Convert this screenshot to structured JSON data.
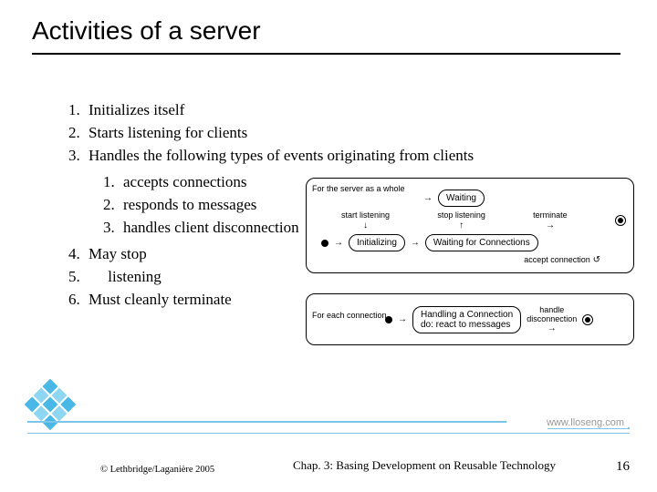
{
  "title": "Activities of a server",
  "list": {
    "items": [
      "Initializes itself",
      "Starts listening for clients",
      "Handles the following types of events originating from clients"
    ],
    "sub_items": [
      "accepts connections",
      "responds to messages",
      "handles client disconnection"
    ],
    "items_after": [
      "May stop",
      "     listening",
      "Must cleanly terminate"
    ]
  },
  "diagram": {
    "group1_label": "For the server as a whole",
    "state_waiting": "Waiting",
    "state_initializing": "Initializing",
    "state_waiting_conn": "Waiting for Connections",
    "lbl_start": "start listening",
    "lbl_stop": "stop listening",
    "lbl_terminate": "terminate",
    "lbl_accept": "accept connection",
    "group2_label": "For each connection",
    "state_handling": "Handling a Connection\ndo: react to messages",
    "lbl_handle_disc": "handle\ndisconnection"
  },
  "footer": {
    "url": "www.lloseng.com",
    "copyright": "© Lethbridge/Laganière 2005",
    "chapter": "Chap. 3: Basing Development on Reusable Technology",
    "page": "16"
  }
}
